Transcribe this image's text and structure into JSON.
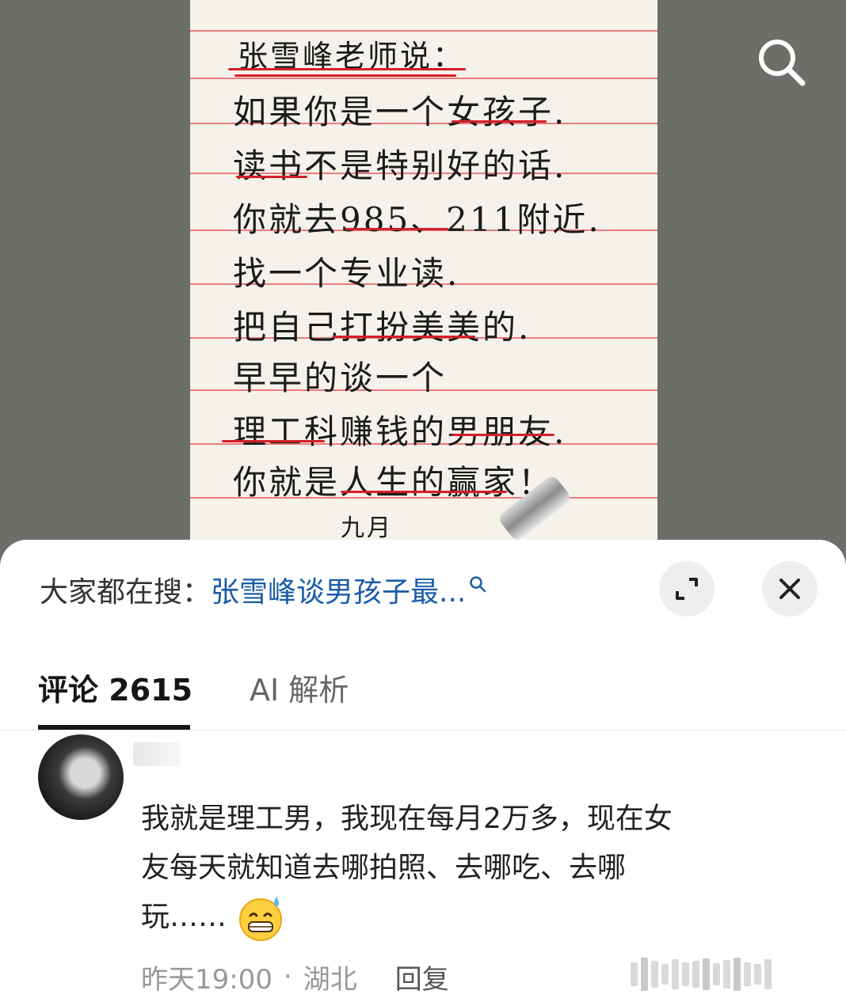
{
  "photo": {
    "lines": [
      "张雪峰老师说：",
      "如果你是一个女孩子.",
      "读书不是特别好的话.",
      "你就去985、211附近.",
      "找一个专业读.",
      "把自己打扮美美的.",
      "早早的谈一个",
      "理工科赚钱的男朋友.",
      "你就是人生的赢家！",
      "九月"
    ]
  },
  "hot_search": {
    "label": "大家都在搜：",
    "query": "张雪峰谈男孩子最..."
  },
  "tabs": {
    "comments_label": "评论",
    "comments_count": "2615",
    "ai_label": "AI 解析"
  },
  "comment": {
    "text_line1": "我就是理工男，我现在每月2万多，现在女",
    "text_line2": "友每天就知道去哪拍照、去哪吃、去哪",
    "text_line3": "玩……",
    "emoji": "grinning-sweat-emoji",
    "time": "昨天19:00",
    "location": "湖北",
    "reply_label": "回复"
  },
  "icons": {
    "search": "search-icon",
    "expand": "expand-icon",
    "close": "close-icon"
  },
  "colors": {
    "link": "#1a5ca8",
    "underline_red": "#d41f2a",
    "rule_red": "#e97d7d"
  }
}
